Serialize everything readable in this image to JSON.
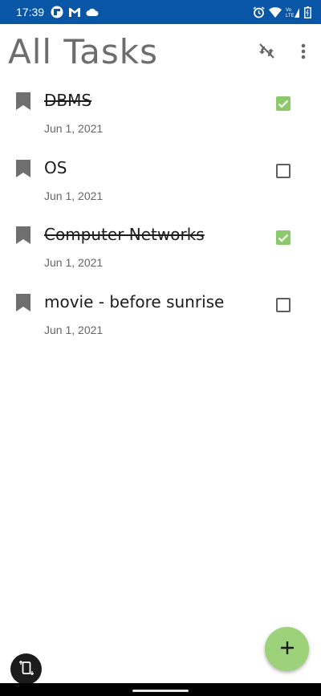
{
  "status_bar": {
    "time": "17:39",
    "left_icons": [
      "flipboard-icon",
      "gmail-icon",
      "cloud-icon"
    ],
    "right_icons": [
      "alarm-icon",
      "wifi-icon",
      "volte-signal-icon",
      "battery-icon"
    ]
  },
  "header": {
    "title": "All Tasks",
    "sync_icon": "sync-disabled-icon",
    "more_icon": "more-vert-icon"
  },
  "tasks": [
    {
      "title": "DBMS",
      "date": "Jun 1, 2021",
      "completed": true
    },
    {
      "title": "OS",
      "date": "Jun 1, 2021",
      "completed": false
    },
    {
      "title": "Computer Networks",
      "date": "Jun 1, 2021",
      "completed": true
    },
    {
      "title": "movie - before sunrise",
      "date": "Jun 1, 2021",
      "completed": false
    }
  ],
  "fab": {
    "icon": "plus-icon"
  },
  "rotate_button": {
    "icon": "screen-rotation-icon"
  },
  "colors": {
    "status_bar": "#0a56a6",
    "title_text": "#6d6d6d",
    "checkbox_checked": "#8bc96a",
    "fab": "#9dd17a"
  }
}
